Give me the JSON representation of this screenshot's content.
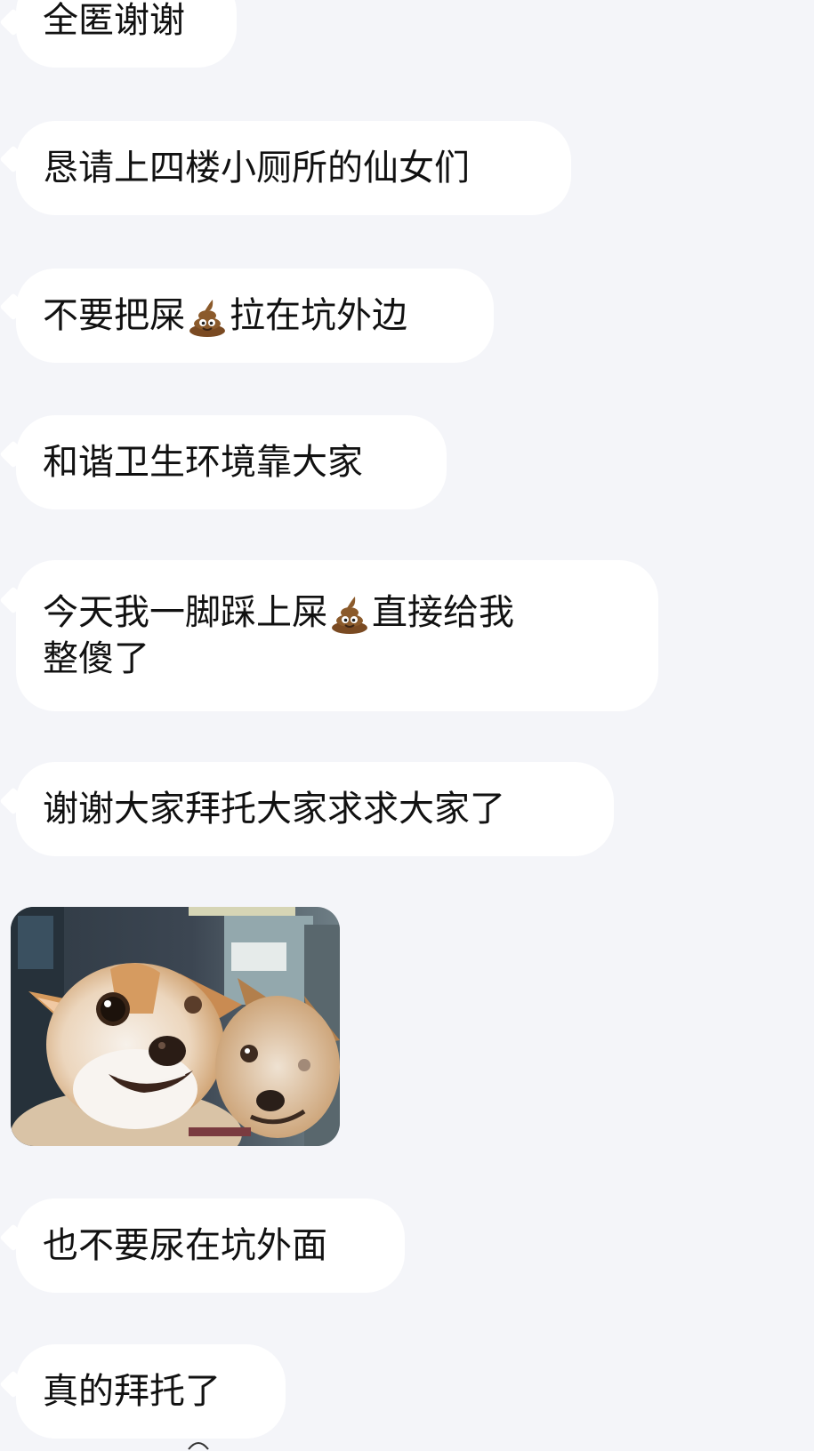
{
  "messages": [
    {
      "type": "text",
      "text": "全匿谢谢"
    },
    {
      "type": "text",
      "text": "恳请上四楼小厕所的仙女们"
    },
    {
      "type": "text",
      "before": "不要把屎",
      "emoji": "pile-of-poo",
      "after": "拉在坑外边"
    },
    {
      "type": "text",
      "text": "和谐卫生环境靠大家"
    },
    {
      "type": "text",
      "line1_before": "今天我一脚踩上屎",
      "emoji": "pile-of-poo",
      "line1_after": "直接给我",
      "line2": "整傻了"
    },
    {
      "type": "text",
      "text": "谢谢大家拜托大家求求大家了"
    },
    {
      "type": "image",
      "description": "chihuahua-meme-photo"
    },
    {
      "type": "text",
      "text": "也不要尿在坑外面"
    },
    {
      "type": "text",
      "text": "真的拜托了"
    }
  ],
  "colors": {
    "background": "#f4f5f9",
    "bubble": "#ffffff",
    "text": "#111111"
  }
}
